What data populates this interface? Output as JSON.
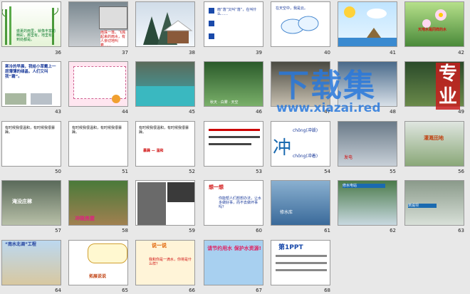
{
  "slides": [
    {
      "num": "36",
      "text": "盛夏的雨里，就像丰富的精彩，那里有，地里有，到处都是。"
    },
    {
      "num": "37",
      "text": "雨珠一落，飞溅起来的雨水，有人亲切地叫着……"
    },
    {
      "num": "38",
      "text": ""
    },
    {
      "num": "39",
      "text": "雨“落”又叫“落”，在叫什么……"
    },
    {
      "num": "40",
      "text": "在天空中，我是云。"
    },
    {
      "num": "41",
      "text": ""
    },
    {
      "num": "42",
      "text": "天地水是同样的水"
    },
    {
      "num": "43",
      "text": "寒冷的早晨，我给小草戴上一层薄薄的绿晶，人们又叫我“霜”。"
    },
    {
      "num": "44",
      "text": ""
    },
    {
      "num": "45",
      "text": ""
    },
    {
      "num": "46",
      "text": "秋天 · 白雾 · 天空"
    },
    {
      "num": "47",
      "text": ""
    },
    {
      "num": "48",
      "text": ""
    },
    {
      "num": "49",
      "text": ""
    },
    {
      "num": "50",
      "text": "有时候我很温和，有时候我很暴躁。"
    },
    {
      "num": "51",
      "text": "有时候我很温和，有时候我很暴躁。"
    },
    {
      "num": "52",
      "text": "有时候我很温和，有时候我很暴躁。"
    },
    {
      "num": "53",
      "text": ""
    },
    {
      "num": "54",
      "text": "冲"
    },
    {
      "num": "55",
      "text": "发电"
    },
    {
      "num": "56",
      "text": "灌溉田地"
    },
    {
      "num": "57",
      "text": "淹没庄稼"
    },
    {
      "num": "58",
      "text": "冲毁房屋"
    },
    {
      "num": "59",
      "text": ""
    },
    {
      "num": "60",
      "text": "想一想"
    },
    {
      "num": "61",
      "text": "修水库"
    },
    {
      "num": "62",
      "text": "修水电站"
    },
    {
      "num": "63",
      "text": "筑堤坝"
    },
    {
      "num": "64",
      "text": "“南水北调”工程"
    },
    {
      "num": "65",
      "text": "拓展说说"
    },
    {
      "num": "66",
      "text": "说一说"
    },
    {
      "num": "67",
      "text": "请节约用水 保护水资源!"
    },
    {
      "num": "68",
      "text": "第1PPT"
    }
  ],
  "slide54": {
    "top": "chōng(冲毁)",
    "bottom": "chōng(冲着)"
  },
  "slide60": {
    "title": "想一想",
    "body": "你能帮人们想想办法，让水多做好事，而不去做坏事吗？"
  },
  "slide66": {
    "body": "我和你是一滴水，你将是什么样？"
  },
  "slide52": {
    "word": "暴躁 — 温和"
  },
  "watermark": {
    "big": "下载集",
    "small": "www.xiazai.red",
    "corner": "专业"
  }
}
